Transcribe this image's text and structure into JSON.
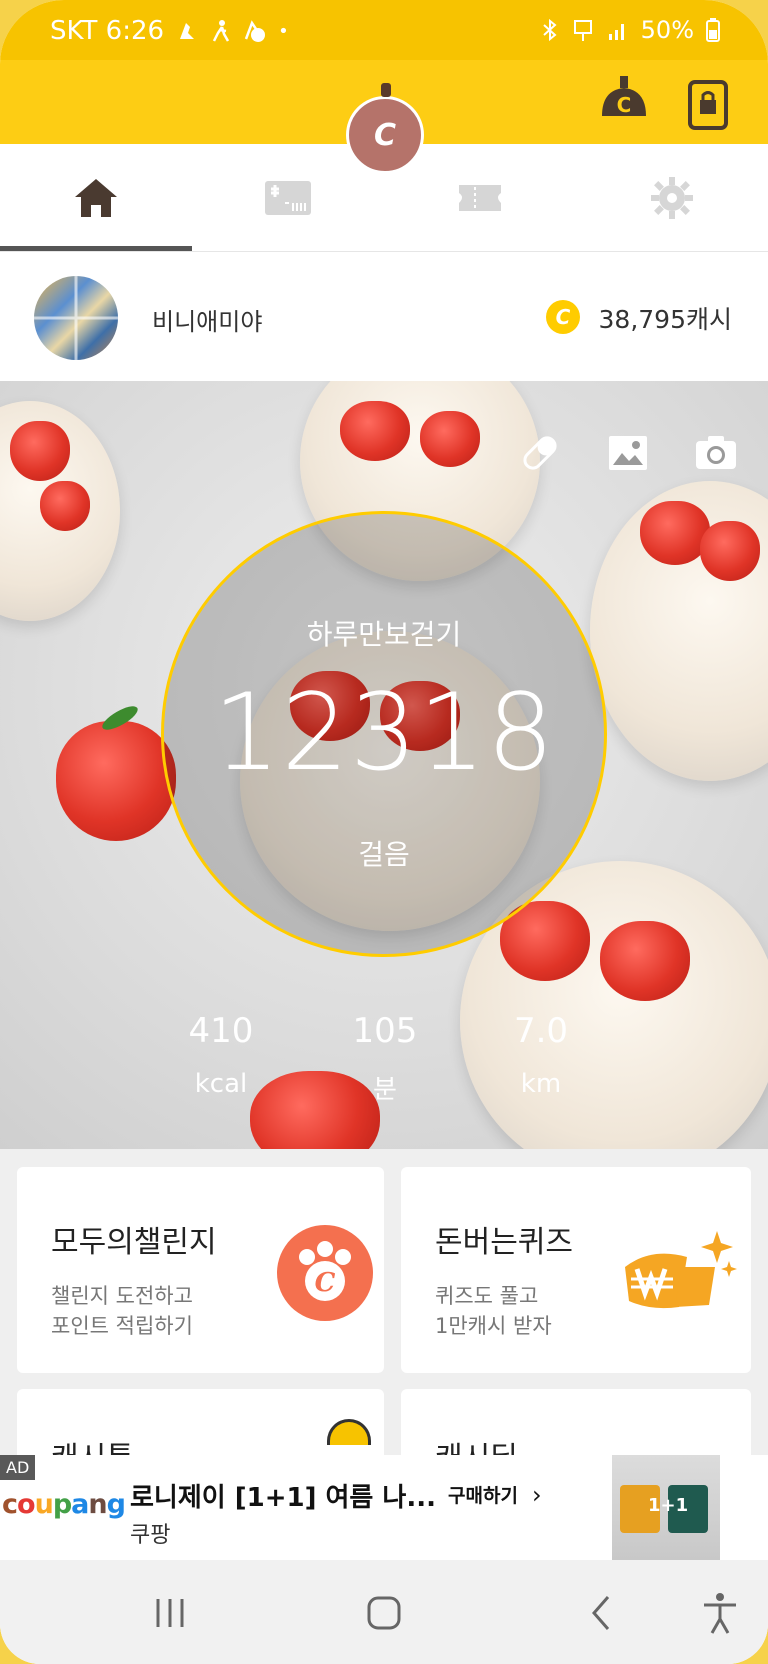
{
  "status_bar": {
    "carrier_time": "SKT 6:26",
    "dot": "•",
    "battery": "50%",
    "icons": [
      "walk-app-icon",
      "walker-icon",
      "cash-app-icon",
      "bluetooth-icon",
      "5g-icon",
      "signal-icon",
      "battery-icon"
    ]
  },
  "header": {
    "center_badge_icon": "coin-character-icon",
    "right_icons": [
      "cash-bag-icon",
      "phone-lock-icon"
    ]
  },
  "tabs": [
    {
      "name": "home",
      "icon": "home-icon",
      "active": true
    },
    {
      "name": "shop",
      "icon": "store-icon",
      "active": false
    },
    {
      "name": "coupon",
      "icon": "ticket-icon",
      "active": false
    },
    {
      "name": "settings",
      "icon": "gear-icon",
      "active": false
    }
  ],
  "profile": {
    "username": "비니애미야",
    "cash": "38,795캐시",
    "coin_letter": "C"
  },
  "hero": {
    "tools": [
      "pill-icon",
      "image-icon",
      "camera-icon"
    ],
    "title": "하루만보걷기",
    "steps": "12318",
    "steps_unit": "걸음",
    "stats": [
      {
        "value": "410",
        "unit": "kcal"
      },
      {
        "value": "105",
        "unit": "분"
      },
      {
        "value": "7.0",
        "unit": "km"
      }
    ]
  },
  "cards": [
    {
      "title": "모두의챌린지",
      "sub1": "챌린지 도전하고",
      "sub2": "포인트 적립하기",
      "icon": "paw-coin-icon"
    },
    {
      "title": "돈버는퀴즈",
      "sub1": "퀴즈도 풀고",
      "sub2": "1만캐시 받자",
      "icon": "won-sparkle-icon"
    },
    {
      "title": "캐시톡",
      "icon": "cash-hat-icon"
    },
    {
      "title": "캐시딜"
    }
  ],
  "ad": {
    "badge": "AD",
    "logo": "coupang",
    "logo_colors": [
      "#a0522d",
      "#e53935",
      "#f9a825",
      "#43a047",
      "#1e88e5",
      "#6d4c41",
      "#1e88e5"
    ],
    "title": "로니제이 [1+1] 여름 나...",
    "advertiser": "쿠팡",
    "cta": "구매하기",
    "image_tag": "1+1"
  },
  "navbar": {
    "buttons": [
      "recent-apps-icon",
      "home-circle-icon",
      "back-icon",
      "accessibility-icon"
    ]
  },
  "colors": {
    "brand_yellow": "#fdcd14",
    "ring_yellow": "#ffcc00",
    "paw_orange": "#f4704f",
    "quiz_orange": "#f5a623"
  }
}
